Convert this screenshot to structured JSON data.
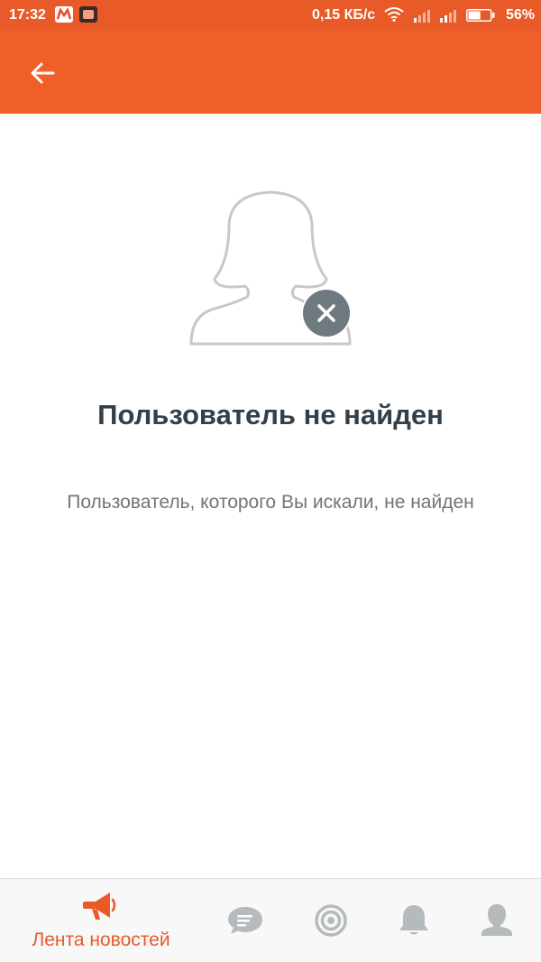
{
  "status_bar": {
    "time": "17:32",
    "network_speed": "0,15 КБ/с",
    "battery_percent": "56%",
    "battery_level": 0.56
  },
  "toolbar": {
    "back_icon": "arrow-left-icon"
  },
  "empty_state": {
    "illustration_icon": "user-not-found-icon",
    "title": "Пользователь не найден",
    "subtitle": "Пользователь, которого Вы искали, не найден"
  },
  "bottom_nav": {
    "items": [
      {
        "label": "Лента новостей",
        "icon": "megaphone-icon",
        "active": true
      },
      {
        "label": "",
        "icon": "chat-bubble-icon",
        "active": false
      },
      {
        "label": "",
        "icon": "target-icon",
        "active": false
      },
      {
        "label": "",
        "icon": "bell-icon",
        "active": false
      },
      {
        "label": "",
        "icon": "person-icon",
        "active": false
      }
    ]
  },
  "colors": {
    "status_bar": "#e85a28",
    "toolbar": "#f05f27",
    "accent": "#e85a28",
    "title_text": "#33404a",
    "subtitle_text": "#6f7579",
    "inactive_icon": "#b5babd"
  }
}
